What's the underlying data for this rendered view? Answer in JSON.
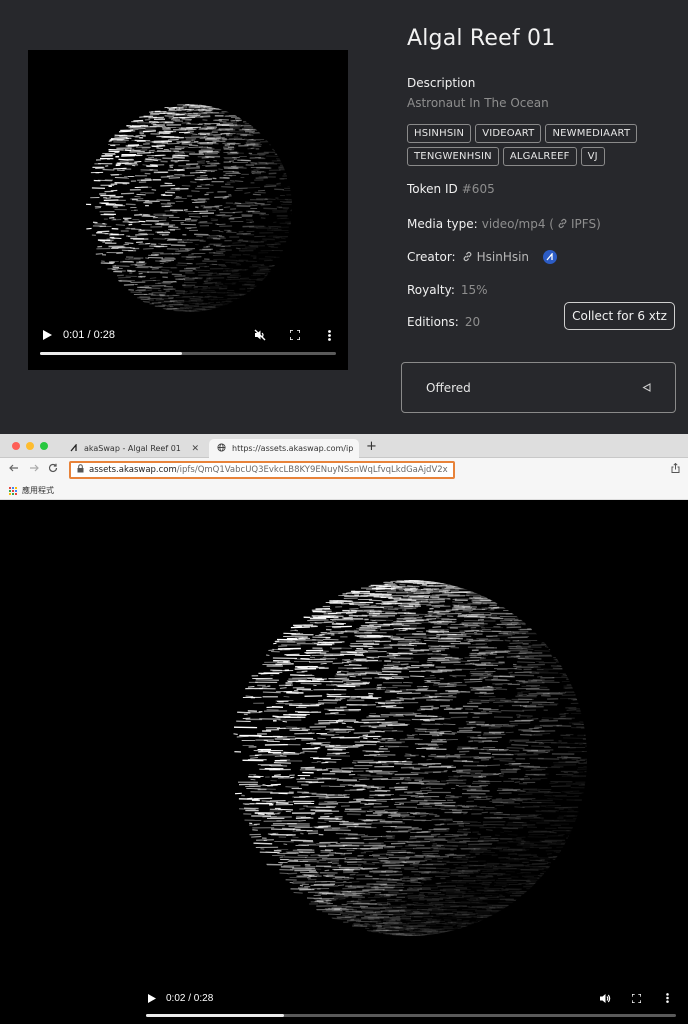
{
  "nft": {
    "title": "Algal Reef 01",
    "description_label": "Description",
    "description": "Astronaut In The Ocean",
    "tags": [
      "HSINHSIN",
      "VIDEOART",
      "NEWMEDIAART",
      "TENGWENHSIN",
      "ALGALREEF",
      "VJ"
    ],
    "token_id_label": "Token ID",
    "token_id": "#605",
    "media_type_label": "Media type:",
    "media_type": "video/mp4 (",
    "media_source": "IPFS)",
    "creator_label": "Creator:",
    "creator": "HsinHsin",
    "royalty_label": "Royalty:",
    "royalty": "15%",
    "editions_label": "Editions:",
    "editions": "20",
    "collect_label": "Collect for 6 xtz",
    "offered_label": "Offered"
  },
  "player1": {
    "time": "0:01 / 0:28",
    "progress": 0.48
  },
  "browser": {
    "tabs": [
      {
        "title": "akaSwap - Algal Reef 01",
        "active": false
      },
      {
        "title": "https://assets.akaswap.com/ip",
        "active": true
      }
    ],
    "url_host": "assets.akaswap.com",
    "url_path": "/ipfs/QmQ1VabcUQ3EvkcLB8KY9ENuyNSsnWqLfvqLkdGaAjdV2x",
    "bookmark_label": "應用程式"
  },
  "player2": {
    "time": "0:02 / 0:28",
    "progress": 0.26
  },
  "colors": {
    "panel_bg": "#27282c",
    "url_highlight": "#e8833a",
    "creator_badge": "#2c5cc5"
  }
}
